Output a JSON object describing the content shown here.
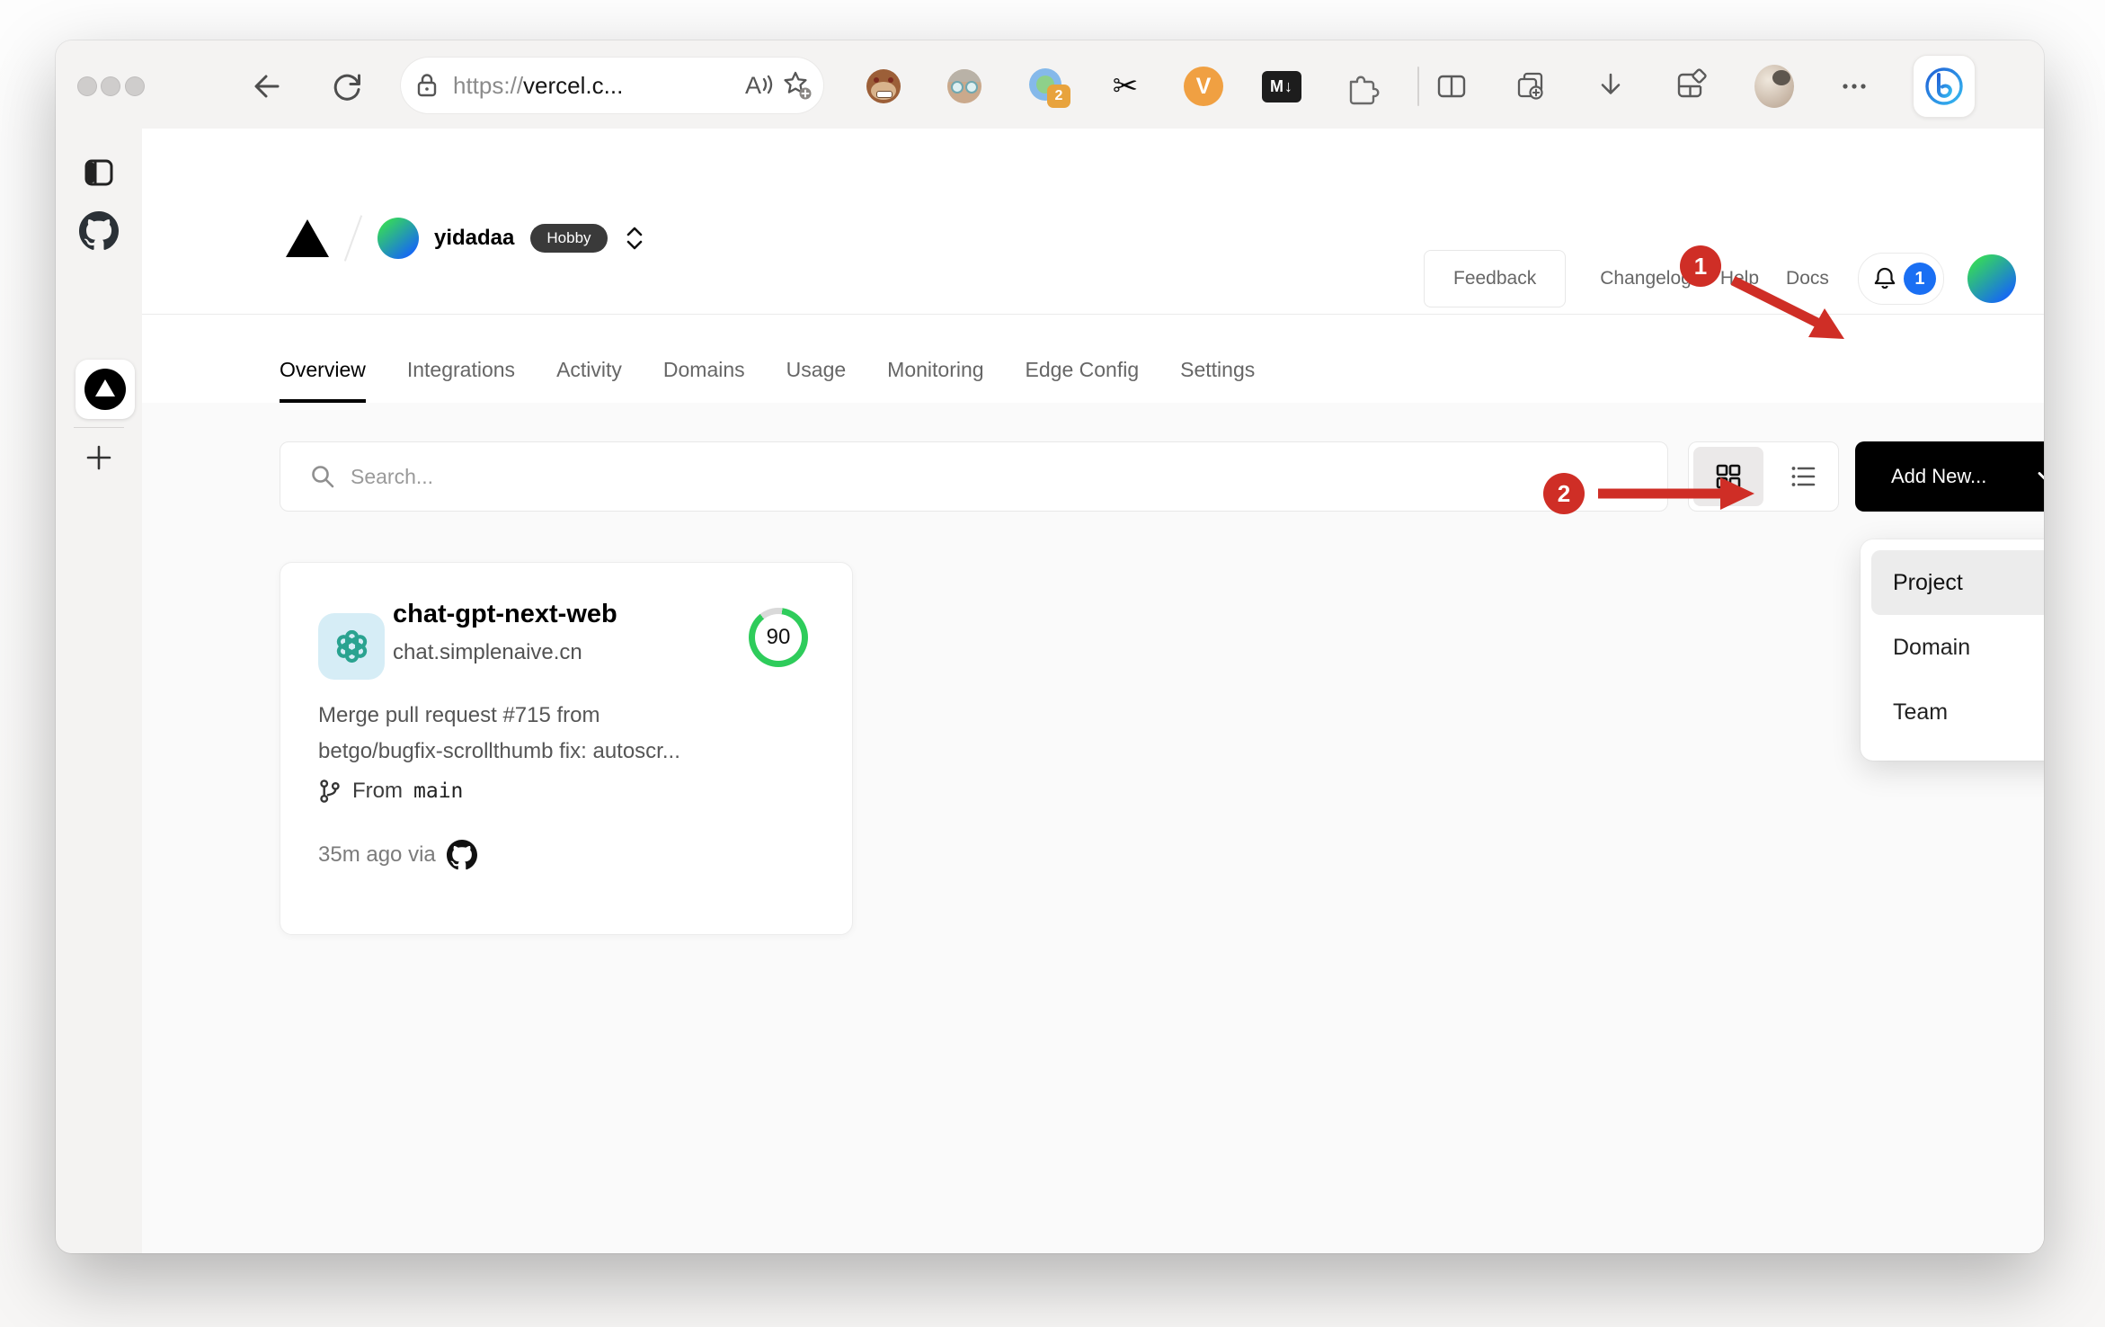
{
  "chrome": {
    "url_prefix": "https://",
    "url_host": "vercel.c...",
    "ext_badge": "2",
    "v_ext_label": "V",
    "md_ext_label": "M↓",
    "scissors_glyph": "✂"
  },
  "header": {
    "team_name": "yidadaa",
    "plan_badge": "Hobby",
    "feedback": "Feedback",
    "changelog": "Changelog",
    "help": "Help",
    "docs": "Docs",
    "notification_count": "1"
  },
  "tabs": [
    "Overview",
    "Integrations",
    "Activity",
    "Domains",
    "Usage",
    "Monitoring",
    "Edge Config",
    "Settings"
  ],
  "toolbar": {
    "search_placeholder": "Search...",
    "add_new_label": "Add New..."
  },
  "dropdown": [
    "Project",
    "Domain",
    "Team"
  ],
  "card": {
    "name": "chat-gpt-next-web",
    "domain": "chat.simplenaive.cn",
    "score": "90",
    "commit_line1": "Merge pull request #715 from",
    "commit_line2": "betgo/bugfix-scrollthumb fix: autoscr...",
    "branch_label": "From",
    "branch_name": "main",
    "meta": "35m ago via"
  },
  "annotations": {
    "step1": "1",
    "step2": "2"
  },
  "colors": {
    "annotation_red": "#cf2e26",
    "gauge_green": "#2ecc5b",
    "notification_blue": "#1a6ff3",
    "hobby_badge": "#3a3a3a",
    "add_new_black": "#000000"
  }
}
